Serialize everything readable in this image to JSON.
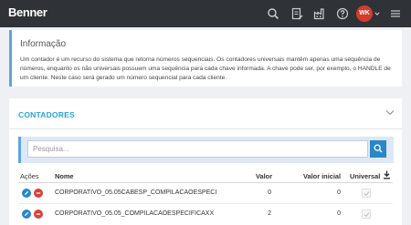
{
  "header": {
    "logo": "Benner",
    "avatar_initials": "WK",
    "colors": {
      "bar": "#2f3237",
      "avatar": "#d53c2c"
    },
    "icons": [
      "search-icon",
      "document-icon",
      "factory-icon",
      "help-icon",
      "user-avatar",
      "menu-icon"
    ]
  },
  "info": {
    "title": "Informação",
    "text": "Um contador é um recurso do sistema que retorna números sequenciais. Os contadores universais mantêm apenas uma sequência de números, enquanto os não universais possuem uma sequência para cada chave informada. A chave pode ser, por exemplo, o HANDLE de um cliente. Neste caso será gerado um número sequencial para cada cliente."
  },
  "counters": {
    "title": "CONTADORES",
    "search_placeholder": "Pesquisa...",
    "columns": {
      "actions": "Ações",
      "name": "Nome",
      "value": "Valor",
      "initial_value": "Valor inicial",
      "universal": "Universal"
    },
    "rows": [
      {
        "name": "CORPORATIVO_05.05CABESP_COMPILACAOESPECI",
        "value": "0",
        "initial_value": "0",
        "universal": true
      },
      {
        "name": "CORPORATIVO_05.05_COMPILACAOESPECIFICAXX",
        "value": "2",
        "initial_value": "0",
        "universal": true
      }
    ],
    "colors": {
      "accent": "#2aa3d6",
      "edit": "#2a86c9",
      "delete": "#d9423a"
    }
  }
}
